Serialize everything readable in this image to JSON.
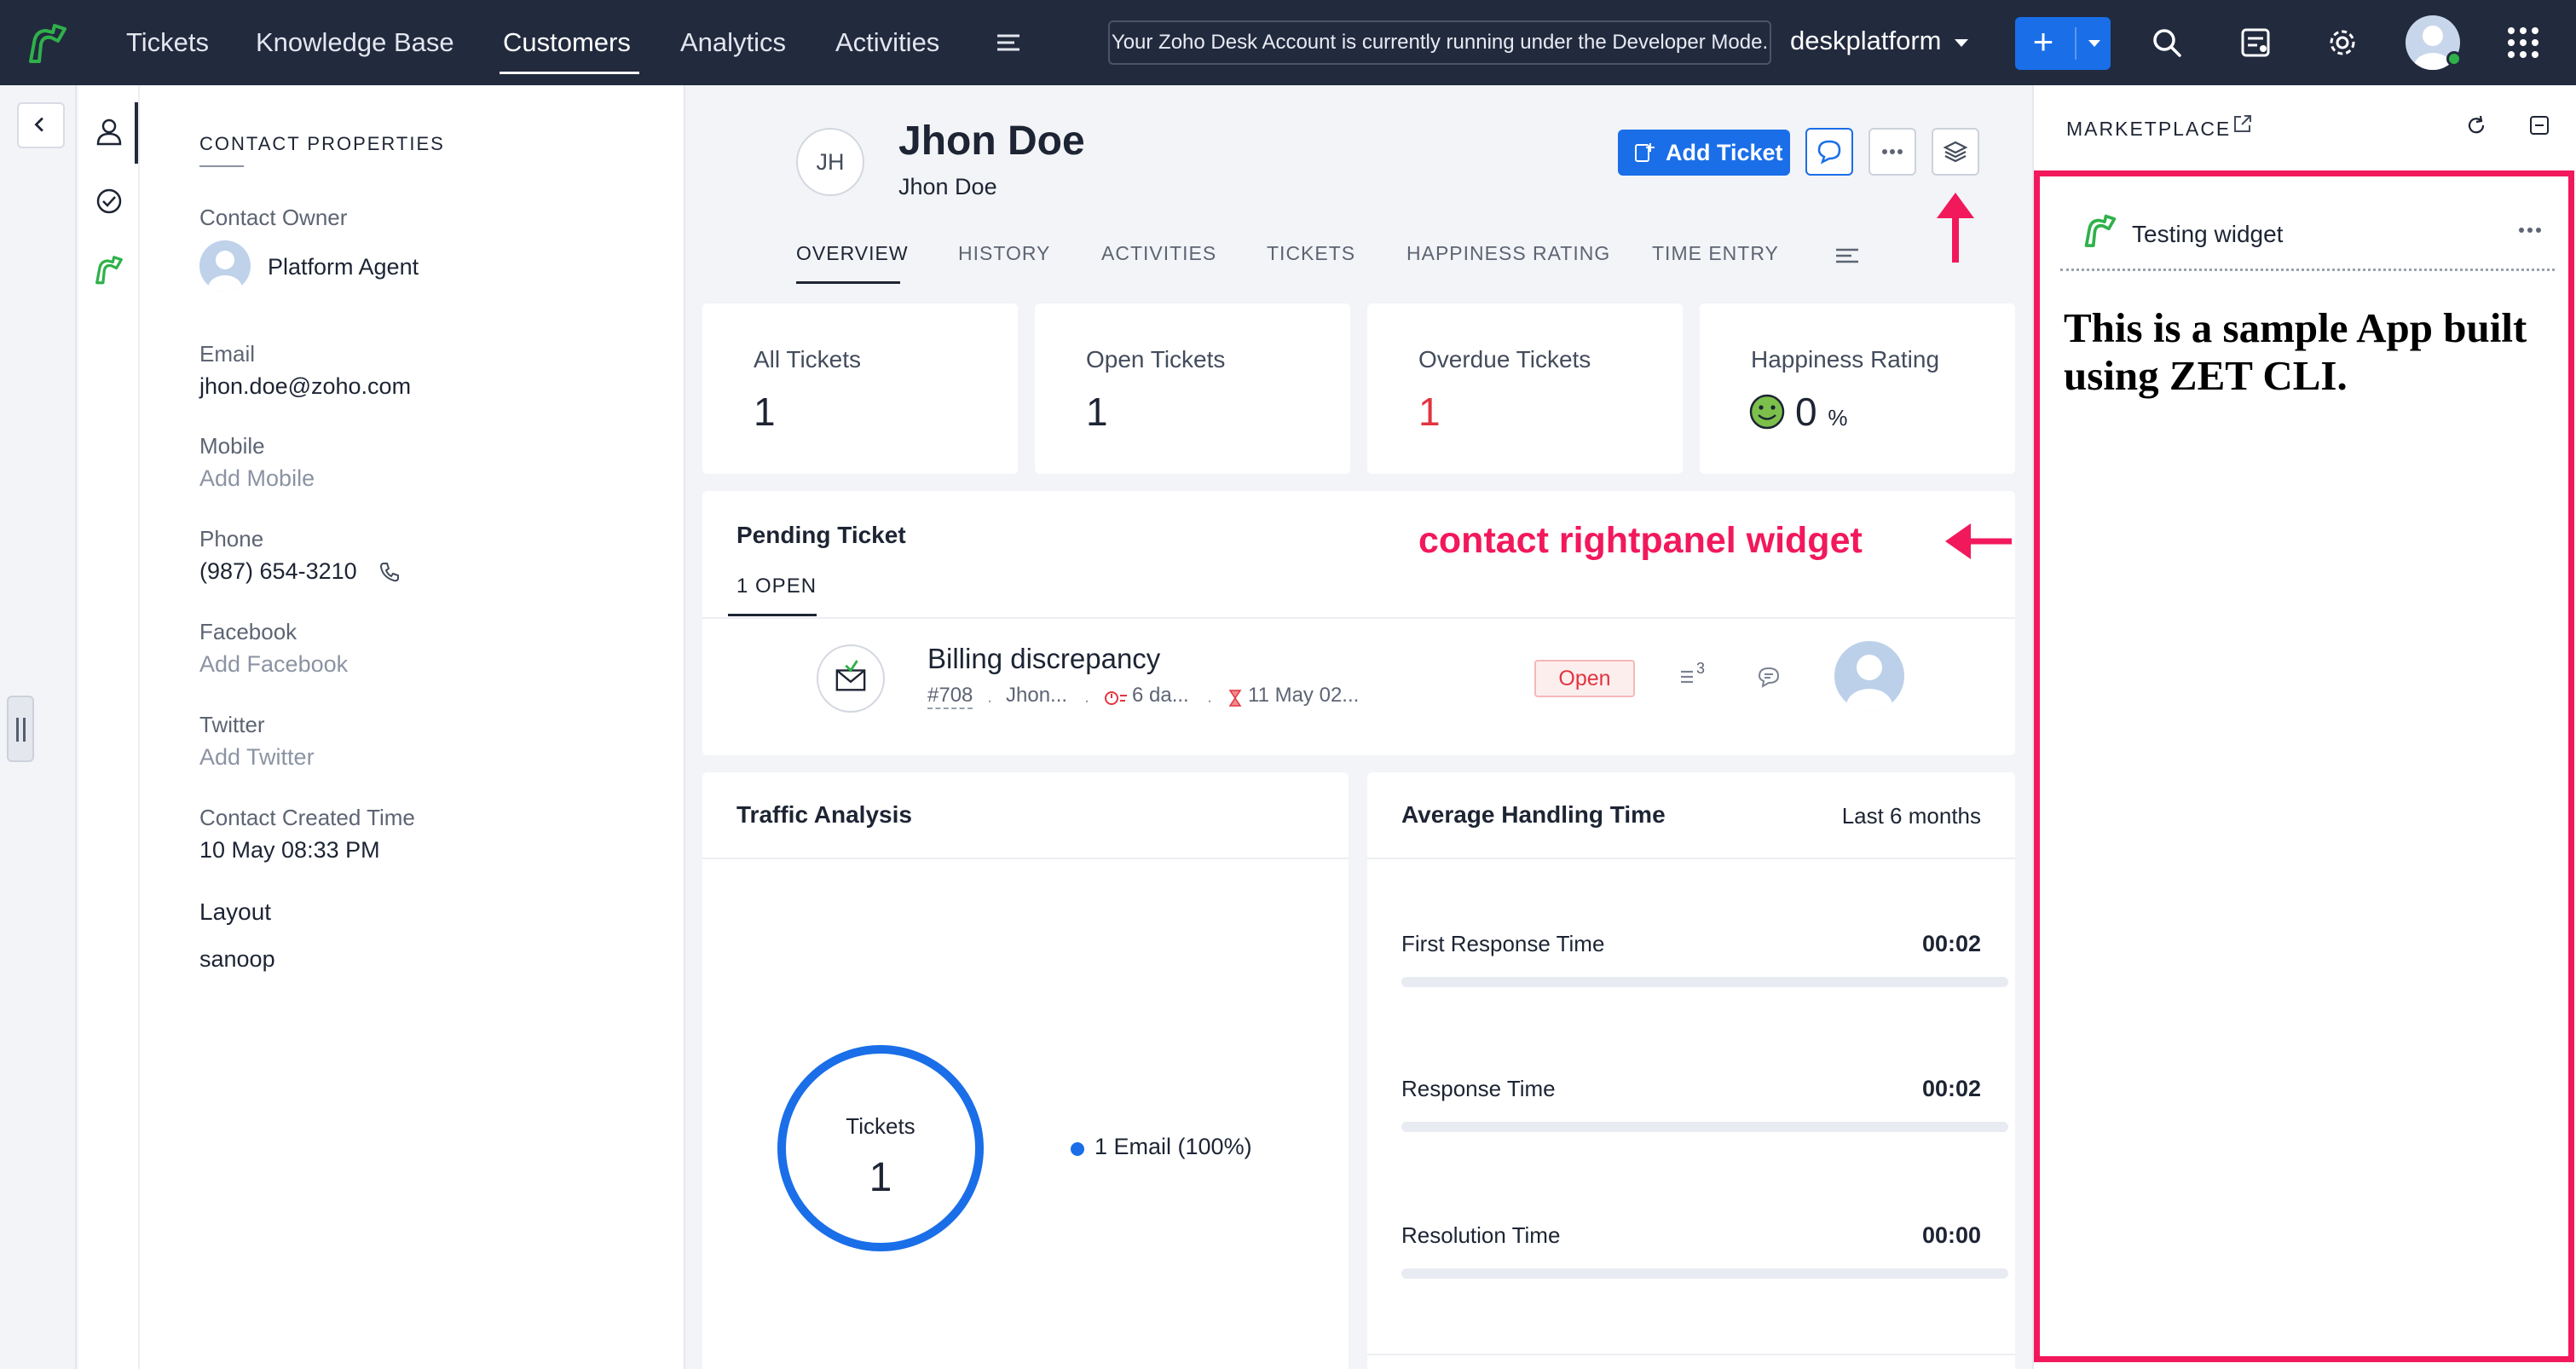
{
  "topbar": {
    "nav": [
      "Tickets",
      "Knowledge Base",
      "Customers",
      "Analytics",
      "Activities"
    ],
    "active_nav": "Customers",
    "dev_mode_notice": "Your Zoho Desk Account is currently running under the Developer Mode.",
    "portal_name": "deskplatform",
    "add_label": "+",
    "icons": [
      "search-icon",
      "notes-icon",
      "gear-icon",
      "avatar",
      "apps-grid-icon"
    ]
  },
  "contact_properties": {
    "heading": "CONTACT PROPERTIES",
    "owner_label": "Contact Owner",
    "owner_value": "Platform Agent",
    "email_label": "Email",
    "email_value": "jhon.doe@zoho.com",
    "mobile_label": "Mobile",
    "mobile_value": "Add Mobile",
    "phone_label": "Phone",
    "phone_value": "(987) 654-3210",
    "facebook_label": "Facebook",
    "facebook_value": "Add Facebook",
    "twitter_label": "Twitter",
    "twitter_value": "Add Twitter",
    "created_label": "Contact Created Time",
    "created_value": "10 May 08:33 PM",
    "layout_label": "Layout",
    "layout_value": "sanoop"
  },
  "contact": {
    "initials": "JH",
    "name": "Jhon Doe",
    "subtitle": "Jhon Doe",
    "add_ticket_label": "Add Ticket"
  },
  "tabs": [
    "OVERVIEW",
    "HISTORY",
    "ACTIVITIES",
    "TICKETS",
    "HAPPINESS RATING",
    "TIME ENTRY"
  ],
  "stats": {
    "all_label": "All Tickets",
    "all_value": "1",
    "open_label": "Open Tickets",
    "open_value": "1",
    "overdue_label": "Overdue Tickets",
    "overdue_value": "1",
    "happiness_label": "Happiness Rating",
    "happiness_value": "0",
    "happiness_unit": "%"
  },
  "pending": {
    "title": "Pending Ticket",
    "tab_label": "1 OPEN",
    "annotation": "contact rightpanel widget",
    "ticket": {
      "subject": "Billing discrepancy",
      "number": "#708",
      "contact": "Jhon...",
      "age": "6 da...",
      "due": "11 May 02...",
      "status": "Open",
      "thread_count": "3"
    }
  },
  "traffic": {
    "title": "Traffic Analysis",
    "center_label": "Tickets",
    "center_value": "1",
    "legend": "1 Email (100%)"
  },
  "handling": {
    "title": "Average Handling Time",
    "range": "Last 6 months",
    "metrics": [
      {
        "label": "First Response Time",
        "value": "00:02",
        "fill": 0
      },
      {
        "label": "Response Time",
        "value": "00:02",
        "fill": 0
      },
      {
        "label": "Resolution Time",
        "value": "00:00",
        "fill": 0
      }
    ]
  },
  "marketplace": {
    "title": "MARKETPLACE",
    "widget_name": "Testing widget",
    "widget_body": "This is a sample App built using ZET CLI."
  },
  "colors": {
    "accent": "#1a6ee8",
    "topbar": "#222a3e",
    "highlight": "#f2185c",
    "danger": "#e2343f",
    "brand_green": "#2fb14a"
  }
}
